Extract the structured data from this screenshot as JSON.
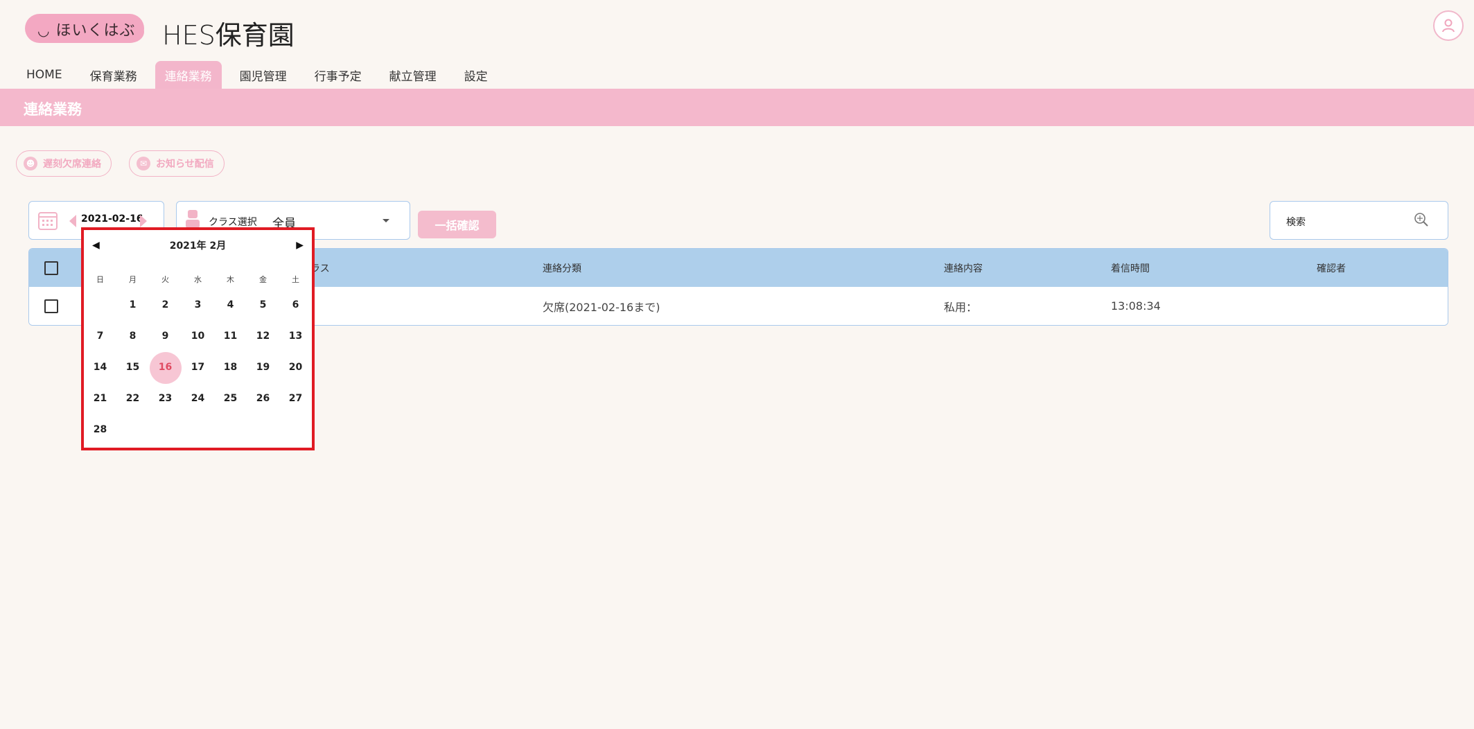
{
  "app": {
    "logo_text": "ほいくはぶ",
    "title": "HES保育園"
  },
  "nav": [
    {
      "label": "HOME"
    },
    {
      "label": "保育業務"
    },
    {
      "label": "連絡業務",
      "active": true
    },
    {
      "label": "園児管理"
    },
    {
      "label": "行事予定"
    },
    {
      "label": "献立管理"
    },
    {
      "label": "設定"
    }
  ],
  "page_title": "連絡業務",
  "actions": {
    "absence_label": "遅刻欠席連絡",
    "notice_label": "お知らせ配信"
  },
  "filters": {
    "date": "2021-02-16",
    "class_label": "クラス選択",
    "class_value": "全員",
    "bulk_confirm": "一括確認",
    "search_placeholder": "検索"
  },
  "table": {
    "headers": {
      "class_partial": "ラス",
      "category": "連絡分類",
      "content": "連絡内容",
      "received": "着信時間",
      "confirmer": "確認者"
    },
    "rows": [
      {
        "category": "欠席(2021-02-16まで)",
        "content": "私用：",
        "received": "13:08:34",
        "confirmer": ""
      }
    ]
  },
  "datepicker": {
    "title": "2021年 2月",
    "dow": [
      "日",
      "月",
      "火",
      "水",
      "木",
      "金",
      "土"
    ],
    "weeks": [
      [
        "",
        "1",
        "2",
        "3",
        "4",
        "5",
        "6"
      ],
      [
        "7",
        "8",
        "9",
        "10",
        "11",
        "12",
        "13"
      ],
      [
        "14",
        "15",
        "16",
        "17",
        "18",
        "19",
        "20"
      ],
      [
        "21",
        "22",
        "23",
        "24",
        "25",
        "26",
        "27"
      ],
      [
        "28",
        "",
        "",
        "",
        "",
        "",
        ""
      ]
    ],
    "selected": "16"
  },
  "colors": {
    "accent_pink": "#f4b8cc",
    "table_header_blue": "#aecfeb",
    "highlight_red": "#e01b24"
  }
}
